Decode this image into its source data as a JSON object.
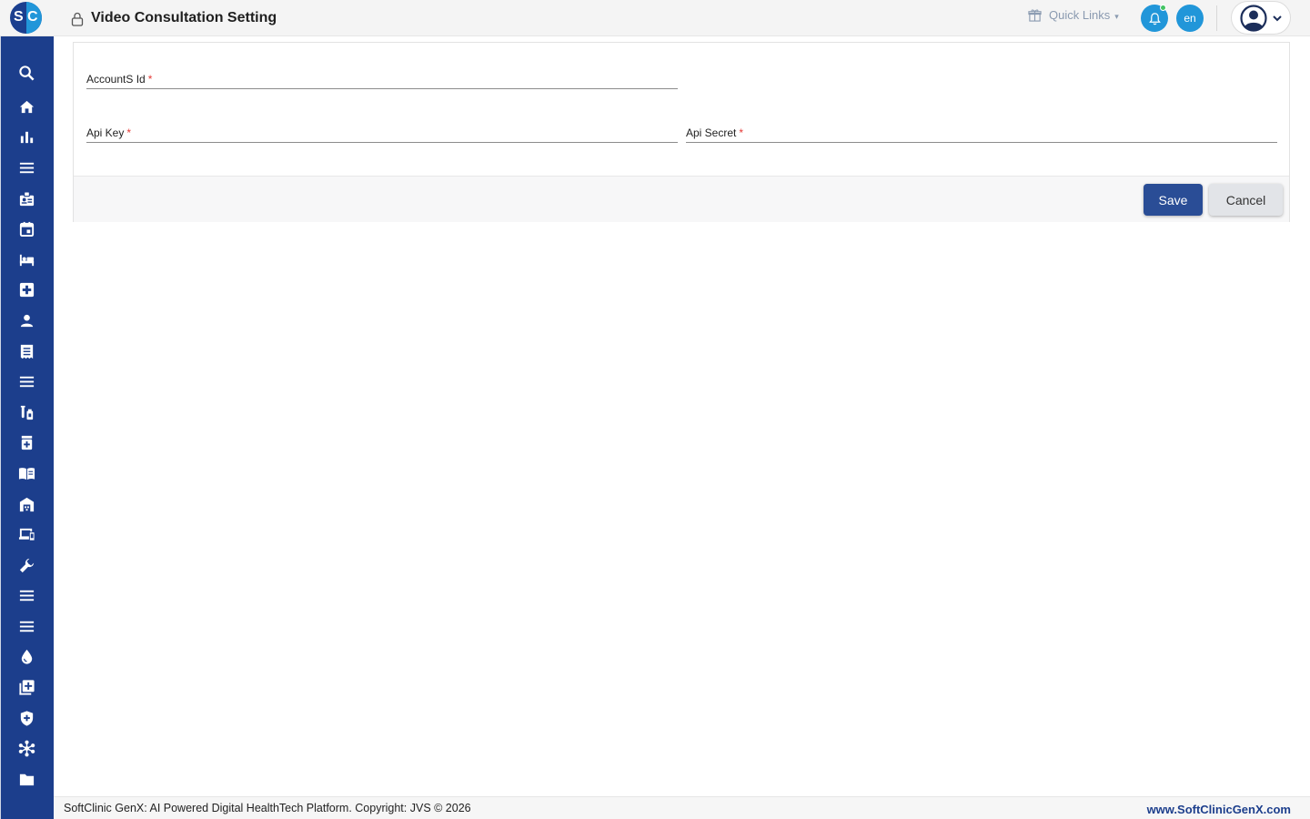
{
  "header": {
    "logo_letters": [
      "S",
      "C"
    ],
    "title": "Video Consultation Setting",
    "quick_links_label": "Quick Links",
    "language_label": "en",
    "colors": {
      "brand_dark": "#1c3e8c",
      "brand_light": "#2196d9",
      "notification_dot": "#43c463"
    }
  },
  "sidebar": {
    "icons": [
      "search-icon",
      "home-icon",
      "bar-chart-icon",
      "menu-icon",
      "badge-icon",
      "calendar-icon",
      "bed-icon",
      "medical-plus-icon",
      "person-icon",
      "receipt-icon",
      "menu-icon",
      "lab-tubes-icon",
      "medicine-bottle-icon",
      "book-icon",
      "warehouse-icon",
      "devices-icon",
      "wrench-icon",
      "menu-icon",
      "menu-icon",
      "blood-drop-icon",
      "add-library-icon",
      "shield-icon",
      "hub-icon",
      "folder-icon"
    ]
  },
  "form": {
    "account_id_label": "AccountS Id",
    "api_key_label": "Api Key",
    "api_secret_label": "Api Secret",
    "required_mark": "*",
    "account_id_value": "",
    "api_key_value": "",
    "api_secret_value": ""
  },
  "actions": {
    "save_label": "Save",
    "cancel_label": "Cancel"
  },
  "footer": {
    "copyright": "SoftClinic GenX: AI Powered Digital HealthTech Platform. Copyright: JVS © 2026",
    "website": "www.SoftClinicGenX.com"
  }
}
